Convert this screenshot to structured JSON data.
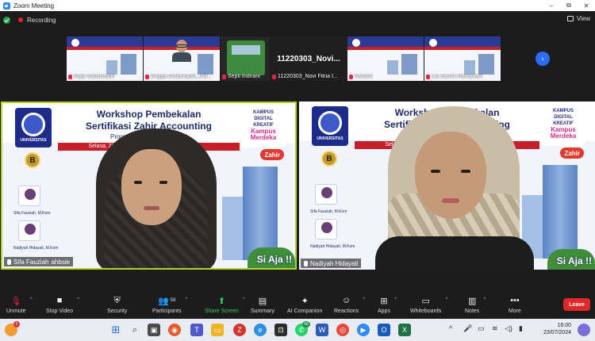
{
  "window": {
    "title": "Zoom Meeting",
    "controls": {
      "minimize": "–",
      "maximize": "⧉",
      "close": "✕"
    }
  },
  "topbar": {
    "recording_label": "Recording",
    "view_label": "View"
  },
  "thumbnails": [
    {
      "name": "Raja Sabaruddin",
      "muted": true,
      "kind": "slide"
    },
    {
      "name": "Angga Ardiansyah_Uni...",
      "muted": true,
      "kind": "person"
    },
    {
      "name": "Septi Indriani",
      "muted": true,
      "kind": "truck"
    },
    {
      "name": "11220303_Novi Fitria I...",
      "muted": true,
      "kind": "name",
      "big_name": "11220303_Novi..."
    },
    {
      "name": "hartanti",
      "muted": true,
      "kind": "slide"
    },
    {
      "name": "Lis Saumi Ramphani",
      "muted": true,
      "kind": "slide"
    }
  ],
  "slide": {
    "title_line1": "Workshop Pembekalan",
    "title_line2": "Sertifikasi Zahir Accounting",
    "program": "Program Studi ... Akuntansi",
    "date": "Selasa, 23 Juli 2024",
    "university_label": "UNIVERSITAS",
    "medal_letter": "B",
    "kampus_line1": "KAMPUS",
    "kampus_line2": "DIGITAL",
    "kampus_line3": "KREATIF",
    "kampus_merdeka": "Kampus Merdeka",
    "zahir_label": "Zahir",
    "speaker1": "Sifa Fauziah, M.Kom",
    "speaker2": "Nadiyah Hidayati, M.Kom",
    "tagline": "Si Aja !!"
  },
  "tiles": {
    "left_name": "Sifa Fauziah",
    "left_name_extra": "ahbsie",
    "right_name": "Nadiyah Hidayati"
  },
  "toolbar": {
    "unmute": "Unmute",
    "stop_video": "Stop Video",
    "security": "Security",
    "participants": "Participants",
    "participants_count": "58",
    "share_screen": "Share Screen",
    "summary": "Summary",
    "ai_companion": "AI Companion",
    "reactions": "Reactions",
    "apps": "Apps",
    "whiteboards": "Whiteboards",
    "notes": "Notes",
    "more": "More",
    "leave": "Leave"
  },
  "taskbar": {
    "time": "16:00",
    "date": "23/07/2024",
    "notification_badge": "1",
    "whatsapp_badge": "68"
  },
  "colors": {
    "accent_green": "#2dcf5a",
    "leave_red": "#e02828",
    "active_speaker_border": "#b6d12a",
    "zoom_blue": "#2d6bff"
  }
}
